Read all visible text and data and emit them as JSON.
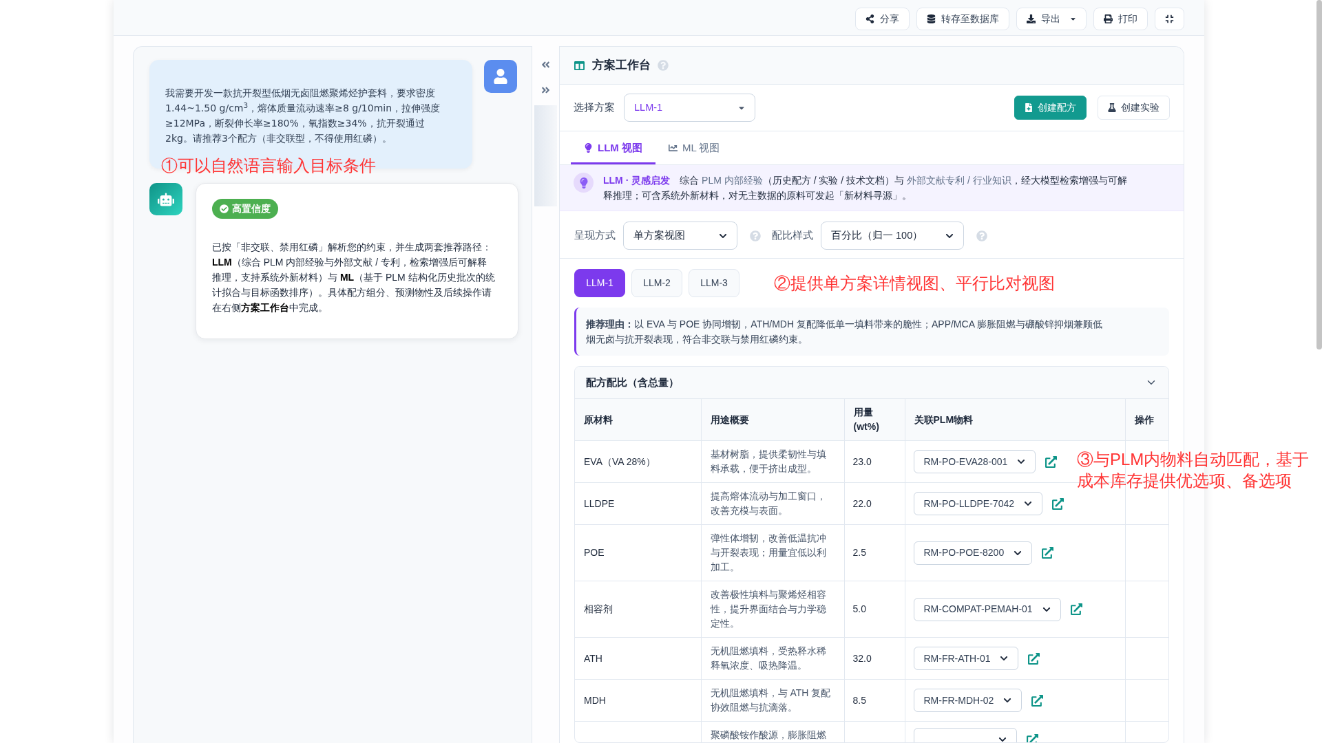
{
  "toolbar": {
    "buttons": [
      {
        "kind": "share",
        "label": "分享",
        "dropdown": false
      },
      {
        "kind": "database",
        "label": "转存至数据库",
        "dropdown": false
      },
      {
        "kind": "download",
        "label": "导出",
        "dropdown": true
      },
      {
        "kind": "print",
        "label": "打印",
        "dropdown": false
      },
      {
        "kind": "compress",
        "dropdown": false
      }
    ]
  },
  "chat": {
    "messages": [
      {
        "kind": "user",
        "text": "我需要开发一款抗开裂型低烟无卤阻燃聚烯烃护套料，要求密度1.44~1.50 g/cm$^{3}$，熔体质量流动速率≥8 g/10min，拉伸强度≥12MPa，断裂伸长率≥180%，氧指数≥34%，抗开裂通过2kg。请推荐3个配方（非交联型，不得使用红磷）。"
      },
      {
        "kind": "assistant",
        "badge": "高置信度",
        "text": "已按「非交联、禁用红磷」解析您的约束，并生成两套推荐路径：**LLM**（综合 PLM 内部经验与外部文献 / 专利，检索增强后可解释推理，支持系统外新材料）与 **ML**（基于 PLM 结构化历史批次的统计拟合与目标函数排序）。具体配方组分、预测物性及后续操作请在右侧**方案工作台**中完成。"
      }
    ],
    "annotation": "①可以自然语言输入目标条件"
  },
  "workbench": {
    "title": "方案工作台",
    "plan_select": {
      "label": "选择方案",
      "value": "LLM-1"
    },
    "actions": [
      {
        "kind": "formula",
        "label": "创建配方",
        "primary": true
      },
      {
        "kind": "experiment",
        "label": "创建实验",
        "primary": false
      }
    ],
    "view_tabs": [
      {
        "kind": "llm",
        "label": "LLM 视图",
        "selected": true
      },
      {
        "kind": "ml",
        "label": "ML 视图",
        "selected": false
      }
    ],
    "banner": {
      "title": "LLM · 灵感启发",
      "segments": [
        {
          "kind": "plain",
          "text": "综合 "
        },
        {
          "kind": "muted",
          "text": "PLM 内部经验"
        },
        {
          "kind": "plain",
          "text": "（历史配方 / 实验 / 技术文档）与 "
        },
        {
          "kind": "muted",
          "text": "外部文献专利 / 行业知识"
        },
        {
          "kind": "plain",
          "text": "，经大模型检索增强与可解释推理；可含系统外新材料，对无主数据的原料可发起「新材料寻源」。"
        }
      ]
    },
    "display_options": [
      {
        "label": "呈现方式",
        "value": "单方案视图"
      },
      {
        "label": "配比样式",
        "value": "百分比（归一 100）"
      }
    ],
    "plan_pills": [
      {
        "label": "LLM-1",
        "selected": true
      },
      {
        "label": "LLM-2",
        "selected": false
      },
      {
        "label": "LLM-3",
        "selected": false
      }
    ],
    "annotation": "②提供单方案详情视图、平行比对视图",
    "reason": "**推荐理由：**以 EVA 与 POE 协同增韧，ATH/MDH 复配降低单一填料带来的脆性；APP/MCA 膨胀阻燃与硼酸锌抑烟兼顾低烟无卤与抗开裂表现，符合非交联与禁用红磷约束。",
    "formula_card": {
      "title": "配方配比（含总量）",
      "expanded": true,
      "columns": [
        "原材料",
        "用途概要",
        "用量 (wt%)",
        "关联PLM物料",
        "操作"
      ],
      "rows": [
        {
          "name": "EVA（VA 28%）",
          "description": "基材树脂，提供柔韧性与填料承载，便于挤出成型。",
          "amount": "23.0",
          "plm_material": "RM-PO-EVA28-001"
        },
        {
          "name": "LLDPE",
          "description": "提高熔体流动与加工窗口，改善充模与表面。",
          "amount": "22.0",
          "plm_material": "RM-PO-LLDPE-7042"
        },
        {
          "name": "POE",
          "description": "弹性体增韧，改善低温抗冲与开裂表现；用量宜低以利加工。",
          "amount": "2.5",
          "plm_material": "RM-PO-POE-8200"
        },
        {
          "name": "相容剂",
          "description": "改善极性填料与聚烯烃相容性，提升界面结合与力学稳定性。",
          "amount": "5.0",
          "plm_material": "RM-COMPAT-PEMAH-01"
        },
        {
          "name": "ATH",
          "description": "无机阻燃填料，受热释水稀释氧浓度、吸热降温。",
          "amount": "32.0",
          "plm_material": "RM-FR-ATH-01"
        },
        {
          "name": "MDH",
          "description": "无机阻燃填料，与 ATH 复配协效阻燃与抗滴落。",
          "amount": "8.5",
          "plm_material": "RM-FR-MDH-02"
        },
        {
          "description": "聚磷酸铵作酸源，膨胀阻燃"
        }
      ]
    },
    "table_annotation": "③与PLM内物料自动匹配，基于成本库存提供优选项、备选项"
  }
}
